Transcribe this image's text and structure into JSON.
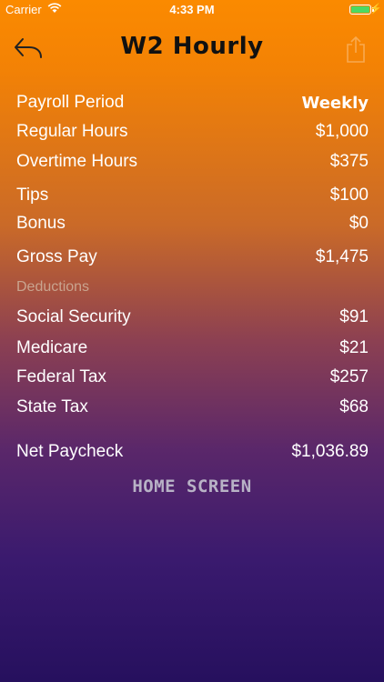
{
  "status_bar": {
    "carrier": "Carrier",
    "time": "4:33 PM",
    "battery_level": 1.0
  },
  "nav": {
    "title": "W2 Hourly",
    "back_icon": "back-arrow-icon",
    "share_icon": "share-icon"
  },
  "rows": [
    {
      "label": "Payroll Period",
      "value": "Weekly"
    },
    {
      "label": "Regular Hours",
      "value": "$1,000"
    },
    {
      "label": "Overtime Hours",
      "value": "$375"
    },
    {
      "label": "Tips",
      "value": "$100"
    },
    {
      "label": "Bonus",
      "value": "$0"
    },
    {
      "label": "Gross Pay",
      "value": "$1,475"
    }
  ],
  "deductions_label": "Deductions",
  "deductions": [
    {
      "label": "Social Security",
      "value": "$91"
    },
    {
      "label": "Medicare",
      "value": "$21"
    },
    {
      "label": "Federal Tax",
      "value": "$257"
    },
    {
      "label": "State Tax",
      "value": "$68"
    }
  ],
  "net": {
    "label": "Net Paycheck",
    "value": "$1,036.89"
  },
  "home_button": "HOME SCREEN",
  "colors": {
    "gradient_top": "#fb8a00",
    "gradient_bottom": "#26105e",
    "battery": "#4cd964"
  }
}
